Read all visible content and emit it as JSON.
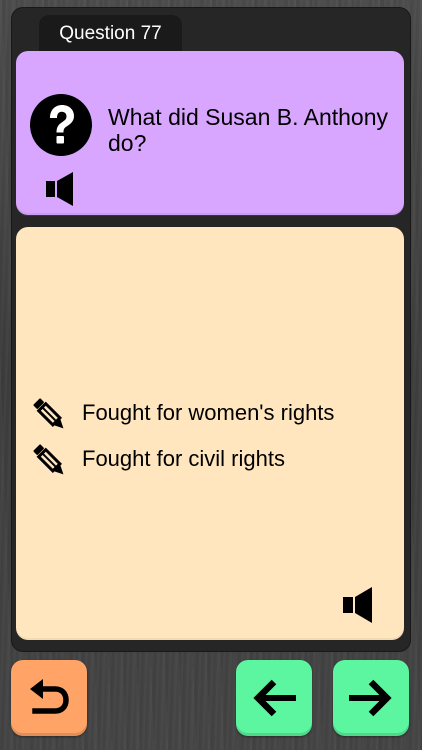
{
  "question_tab": {
    "label": "Question 77"
  },
  "question": {
    "text": "What did Susan B. Anthony do?",
    "icon": "question-mark-icon",
    "audio_icon": "speaker-icon"
  },
  "answers": [
    {
      "text": "Fought for women's rights",
      "icon": "pencil-icon"
    },
    {
      "text": "Fought for civil rights",
      "icon": "pencil-icon"
    }
  ],
  "answer_audio_icon": "speaker-icon",
  "nav": {
    "back_icon": "undo-arrow-icon",
    "prev_icon": "left-arrow-icon",
    "next_icon": "right-arrow-icon"
  },
  "colors": {
    "question_card": "#d9a6ff",
    "answer_card": "#ffe6bf",
    "back_button": "#ffa366",
    "nav_button": "#5cf5a0",
    "panel": "#262626",
    "tab": "#1a1a1a"
  }
}
